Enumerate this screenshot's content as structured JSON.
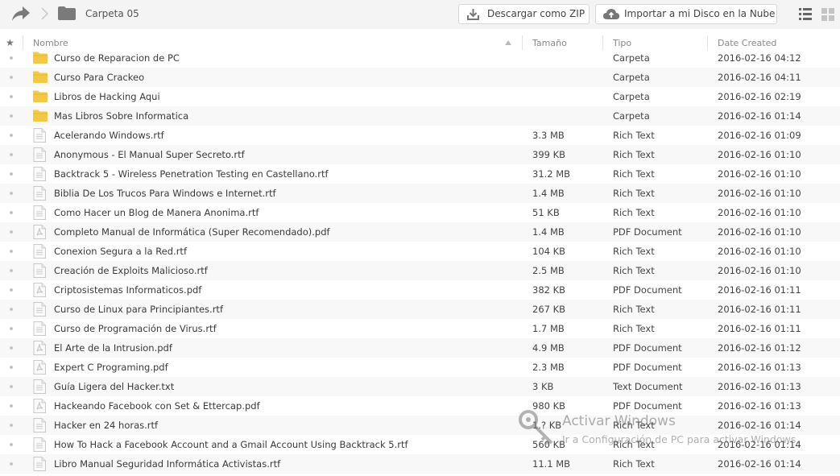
{
  "toolbar": {
    "share_icon": "share-arrow-icon",
    "breadcrumb_separator_icon": "chevron-right-icon",
    "folder_icon": "folder-icon",
    "folder_name": "Carpeta 05",
    "download_zip_label": "Descargar como ZIP",
    "import_cloud_label": "Importar a mi Disco en la Nube",
    "view_list_icon": "list-view-icon",
    "view_grid_icon": "grid-view-icon"
  },
  "table": {
    "columns": {
      "star": "★",
      "name": "Nombre",
      "size": "Tamaño",
      "type": "Tipo",
      "date": "Date Created"
    },
    "sort": {
      "column": "name",
      "direction": "ascending"
    },
    "rows": [
      {
        "name": "Curso de Reparacion de PC",
        "size": "",
        "type": "Carpeta",
        "date": "2016-02-16 04:12",
        "icon": "folder"
      },
      {
        "name": "Curso Para Crackeo",
        "size": "",
        "type": "Carpeta",
        "date": "2016-02-16 04:11",
        "icon": "folder"
      },
      {
        "name": "Libros de Hacking Aqui",
        "size": "",
        "type": "Carpeta",
        "date": "2016-02-16 02:19",
        "icon": "folder"
      },
      {
        "name": "Mas Libros Sobre Informatica",
        "size": "",
        "type": "Carpeta",
        "date": "2016-02-16 01:14",
        "icon": "folder"
      },
      {
        "name": "Acelerando Windows.rtf",
        "size": "3.3 MB",
        "type": "Rich Text",
        "date": "2016-02-16 01:09",
        "icon": "document"
      },
      {
        "name": "Anonymous - El Manual Super Secreto.rtf",
        "size": "399 KB",
        "type": "Rich Text",
        "date": "2016-02-16 01:10",
        "icon": "document"
      },
      {
        "name": "Backtrack 5 - Wireless Penetration Testing en Castellano.rtf",
        "size": "31.2 MB",
        "type": "Rich Text",
        "date": "2016-02-16 01:10",
        "icon": "document"
      },
      {
        "name": "Biblia De Los Trucos Para Windows e Internet.rtf",
        "size": "1.4 MB",
        "type": "Rich Text",
        "date": "2016-02-16 01:10",
        "icon": "document"
      },
      {
        "name": "Como Hacer un Blog de Manera Anonima.rtf",
        "size": "51 KB",
        "type": "Rich Text",
        "date": "2016-02-16 01:10",
        "icon": "document"
      },
      {
        "name": "Completo Manual de Informática (Super Recomendado).pdf",
        "size": "1.4 MB",
        "type": "PDF Document",
        "date": "2016-02-16 01:10",
        "icon": "pdf"
      },
      {
        "name": "Conexion Segura a la Red.rtf",
        "size": "104 KB",
        "type": "Rich Text",
        "date": "2016-02-16 01:10",
        "icon": "document"
      },
      {
        "name": "Creación de Exploits Malicioso.rtf",
        "size": "2.5 MB",
        "type": "Rich Text",
        "date": "2016-02-16 01:10",
        "icon": "document"
      },
      {
        "name": "Criptosistemas Informaticos.pdf",
        "size": "382 KB",
        "type": "PDF Document",
        "date": "2016-02-16 01:11",
        "icon": "pdf"
      },
      {
        "name": "Curso de Linux para Principiantes.rtf",
        "size": "267 KB",
        "type": "Rich Text",
        "date": "2016-02-16 01:11",
        "icon": "document"
      },
      {
        "name": "Curso de Programación de Virus.rtf",
        "size": "1.7 MB",
        "type": "Rich Text",
        "date": "2016-02-16 01:11",
        "icon": "document"
      },
      {
        "name": "El Arte de la Intrusion.pdf",
        "size": "4.9 MB",
        "type": "PDF Document",
        "date": "2016-02-16 01:12",
        "icon": "pdf"
      },
      {
        "name": "Expert C Programing.pdf",
        "size": "2.3 MB",
        "type": "PDF Document",
        "date": "2016-02-16 01:13",
        "icon": "pdf"
      },
      {
        "name": "Guía Ligera del Hacker.txt",
        "size": "3 KB",
        "type": "Text Document",
        "date": "2016-02-16 01:13",
        "icon": "document"
      },
      {
        "name": "Hackeando Facebook con Set & Ettercap.pdf",
        "size": "980 KB",
        "type": "PDF Document",
        "date": "2016-02-16 01:13",
        "icon": "pdf"
      },
      {
        "name": "Hacker en 24 horas.rtf",
        "size": "1.? KB",
        "type": "Rich Text",
        "date": "2016-02-16 01:14",
        "icon": "document"
      },
      {
        "name": "How To Hack a Facebook Account and a Gmail Account Using Backtrack 5.rtf",
        "size": "560 KB",
        "type": "Rich Text",
        "date": "2016-02-16 01:14",
        "icon": "document"
      },
      {
        "name": "Libro Manual Seguridad Informática Activistas.rtf",
        "size": "11.1 MB",
        "type": "Rich Text",
        "date": "2016-02-16 01:14",
        "icon": "document"
      }
    ]
  },
  "watermark": {
    "icon": "key-icon",
    "title": "Activar Windows",
    "subtitle": "Ir a Configuración de PC para activar Windows."
  },
  "colors": {
    "toolbar_bg": "#f4f4f4",
    "folder_yellow": "#f5c842",
    "row_alt": "#f8f8f8",
    "text": "#3a3a3a",
    "header_text": "#888888"
  }
}
